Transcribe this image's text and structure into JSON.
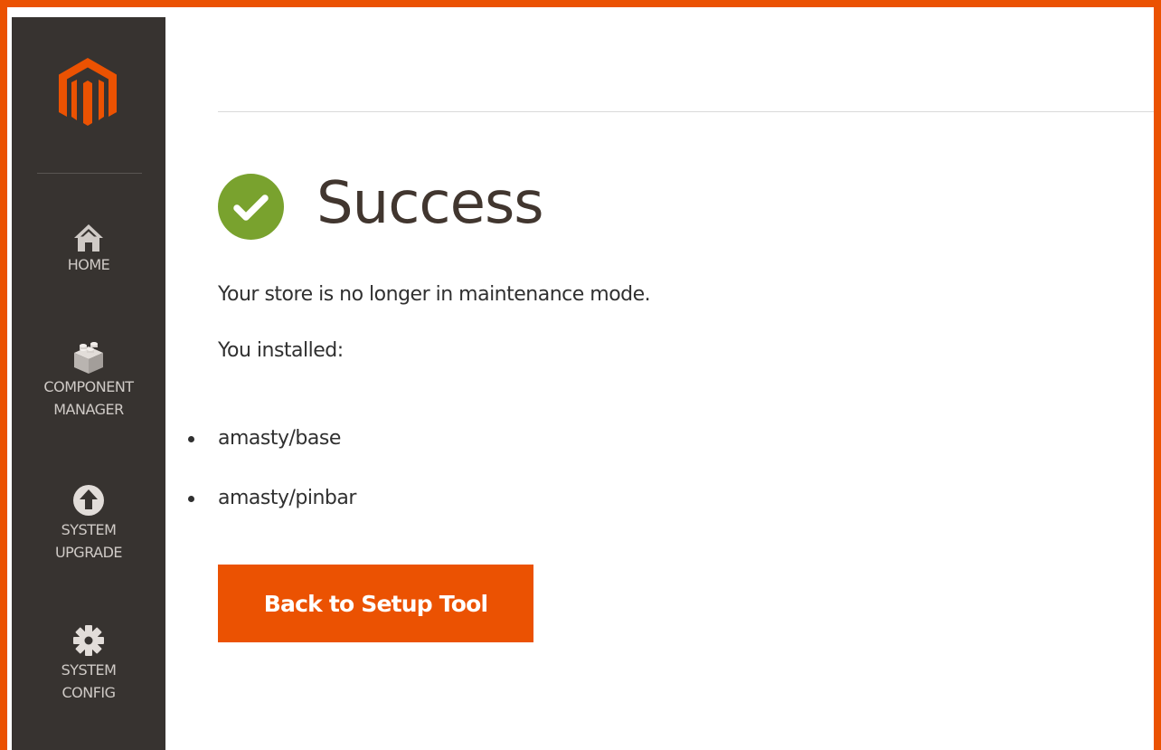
{
  "colors": {
    "accent": "#eb5202",
    "sidebar_bg": "#373330",
    "success_green": "#79a22e",
    "text": "#303030",
    "title_text": "#41362f"
  },
  "sidebar": {
    "logo_icon": "magento-logo-icon",
    "items": [
      {
        "label_lines": [
          "HOME"
        ],
        "icon": "home-icon"
      },
      {
        "label_lines": [
          "COMPONENT",
          "MANAGER"
        ],
        "icon": "component-cube-icon"
      },
      {
        "label_lines": [
          "SYSTEM",
          "UPGRADE"
        ],
        "icon": "upload-arrow-icon"
      },
      {
        "label_lines": [
          "SYSTEM",
          "CONFIG"
        ],
        "icon": "gear-icon"
      }
    ]
  },
  "main": {
    "status_icon": "success-check-icon",
    "title": "Success",
    "maintenance_message": "Your store is no longer in maintenance mode.",
    "installed_label": "You installed:",
    "installed_packages": [
      "amasty/base",
      "amasty/pinbar"
    ],
    "back_button_label": "Back to Setup Tool"
  }
}
